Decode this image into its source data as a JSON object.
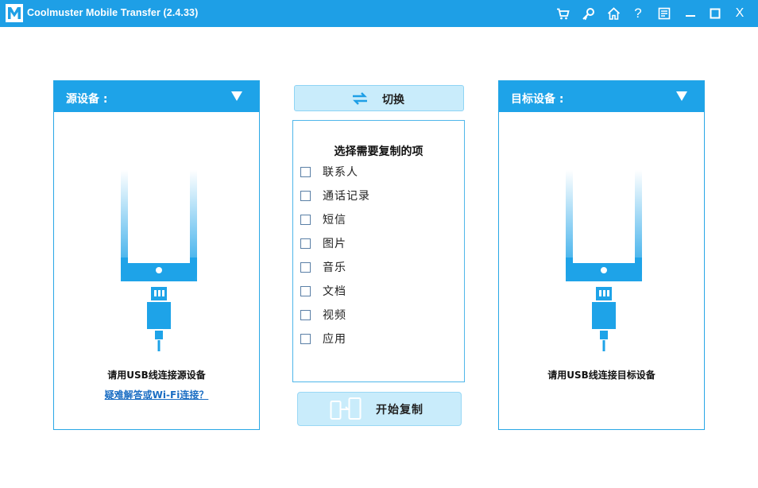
{
  "window": {
    "title": "Coolmuster Mobile Transfer  (2.4.33)"
  },
  "toolbar": {
    "icons": [
      "cart-icon",
      "key-icon",
      "home-icon",
      "help-icon",
      "feedback-icon",
      "minimize-icon",
      "maximize-icon",
      "close-icon"
    ],
    "help_label": "?",
    "close_label": "X"
  },
  "source": {
    "title": "源设备 :",
    "hint": "请用USB线连接源设备",
    "link": "疑难解答或Wi-Fi连接？"
  },
  "target": {
    "title": "目标设备 :",
    "hint": "请用USB线连接目标设备"
  },
  "switch_button": {
    "label": "切换"
  },
  "items": {
    "title": "选择需要复制的项",
    "list": [
      {
        "label": "联系人",
        "checked": false
      },
      {
        "label": "通话记录",
        "checked": false
      },
      {
        "label": "短信",
        "checked": false
      },
      {
        "label": "图片",
        "checked": false
      },
      {
        "label": "音乐",
        "checked": false
      },
      {
        "label": "文档",
        "checked": false
      },
      {
        "label": "视频",
        "checked": false
      },
      {
        "label": "应用",
        "checked": false
      }
    ]
  },
  "start_button": {
    "label": "开始复制"
  },
  "colors": {
    "accent": "#1e9fe6",
    "button_bg": "#c9ecfb"
  }
}
